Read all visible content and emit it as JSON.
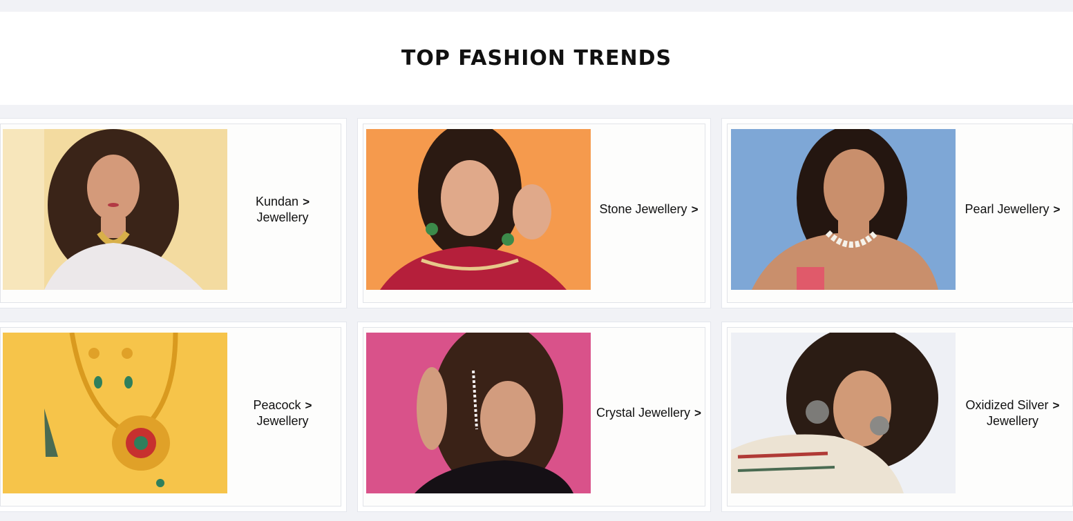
{
  "section": {
    "title": "TOP FASHION TRENDS"
  },
  "cards": [
    {
      "label_line1": "Kundan",
      "label_line2": "Jewellery",
      "image": "model-kundan-choker",
      "bg": "#f3dba0"
    },
    {
      "label_line1": "Stone Jewellery",
      "label_line2": "",
      "image": "model-stone-earrings",
      "bg": "#f59a4d"
    },
    {
      "label_line1": "Pearl Jewellery",
      "label_line2": "",
      "image": "model-pearl-necklace",
      "bg": "#7ea7d6"
    },
    {
      "label_line1": "Peacock",
      "label_line2": "Jewellery",
      "image": "peacock-necklace-set",
      "bg": "#f6c44a"
    },
    {
      "label_line1": "Crystal Jewellery",
      "label_line2": "",
      "image": "model-crystal-earcuff",
      "bg": "#d9528a"
    },
    {
      "label_line1": "Oxidized Silver",
      "label_line2": "Jewellery",
      "image": "model-oxidized-earrings",
      "bg": "#eef0f5"
    }
  ],
  "icons": {
    "chevron": "chevron-right-icon"
  }
}
